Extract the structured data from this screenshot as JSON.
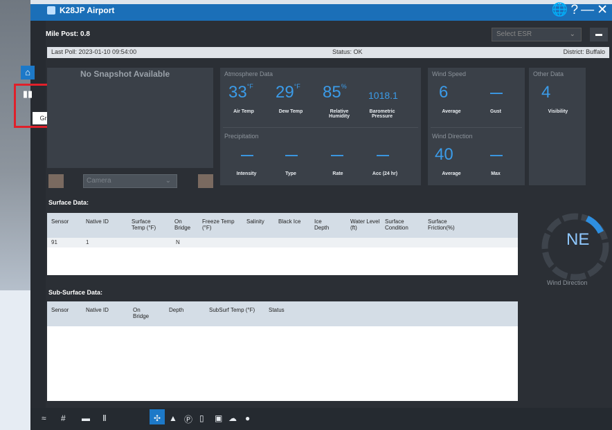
{
  "window": {
    "title": "K28JP Airport"
  },
  "titlebar_icons": [
    "globe-icon",
    "help-icon",
    "minimize-icon",
    "close-icon"
  ],
  "titlebar_glyphs": {
    "globe": "🌐",
    "help": "?",
    "minimize": "—",
    "close": "✕"
  },
  "header": {
    "mile_post": "Mile Post: 0.8",
    "esr_select": "Select ESR"
  },
  "status": {
    "last_poll": "Last Poll: 2023-01-10 09:54:00",
    "status": "Status: OK",
    "district": "District: Buffalo"
  },
  "sidebar": {
    "home_icon": "⌂",
    "graph_icon": "📊",
    "graph_tooltip": "Graph"
  },
  "snapshot": {
    "text": "No Snapshot Available",
    "camera_select": "Camera"
  },
  "atmosphere": {
    "title": "Atmosphere Data",
    "air_temp": "33",
    "air_temp_unit": "°F",
    "air_temp_label": "Air Temp",
    "dew_temp": "29",
    "dew_temp_unit": "°F",
    "dew_temp_label": "Dew Temp",
    "humidity": "85",
    "humidity_unit": "%",
    "humidity_label": "Relative Humidity",
    "pressure": "1018.1",
    "pressure_label": "Barometric Pressure"
  },
  "precipitation": {
    "title": "Precipitation",
    "intensity": "—",
    "intensity_label": "Intensity",
    "type": "—",
    "type_label": "Type",
    "rate": "—",
    "rate_label": "Rate",
    "acc": "—",
    "acc_label": "Acc (24 hr)"
  },
  "wind_speed": {
    "title": "Wind Speed",
    "average": "6",
    "average_label": "Average",
    "gust": "—",
    "gust_label": "Gust"
  },
  "wind_direction": {
    "title": "Wind Direction",
    "average": "40",
    "average_label": "Average",
    "max": "—",
    "max_label": "Max"
  },
  "other": {
    "title": "Other Data",
    "visibility": "4",
    "visibility_label": "Visibility"
  },
  "surface": {
    "title": "Surface Data:",
    "columns": [
      "Sensor",
      "Native ID",
      "Surface Temp (°F)",
      "On Bridge",
      "Freeze Temp (°F)",
      "Salinity",
      "Black Ice",
      "Ice Depth",
      "Water Level (ft)",
      "Surface Condition",
      "Surface Friction(%)"
    ],
    "rows": [
      [
        "91",
        "1",
        "",
        "N",
        "",
        "",
        "",
        "",
        "",
        "",
        ""
      ]
    ]
  },
  "subsurface": {
    "title": "Sub-Surface Data:",
    "columns": [
      "Sensor",
      "Native ID",
      "On Bridge",
      "Depth",
      "SubSurf Temp (°F)",
      "Status"
    ]
  },
  "compass": {
    "direction": "NE",
    "label": "Wind Direction"
  },
  "bottom_toolbar": [
    "waves-icon",
    "grid-icon",
    "minus-icon",
    "bridge-icon",
    "tower-icon",
    "warning-icon",
    "parking-icon",
    "device-icon",
    "sign-icon",
    "weather-icon",
    "dot-icon"
  ]
}
